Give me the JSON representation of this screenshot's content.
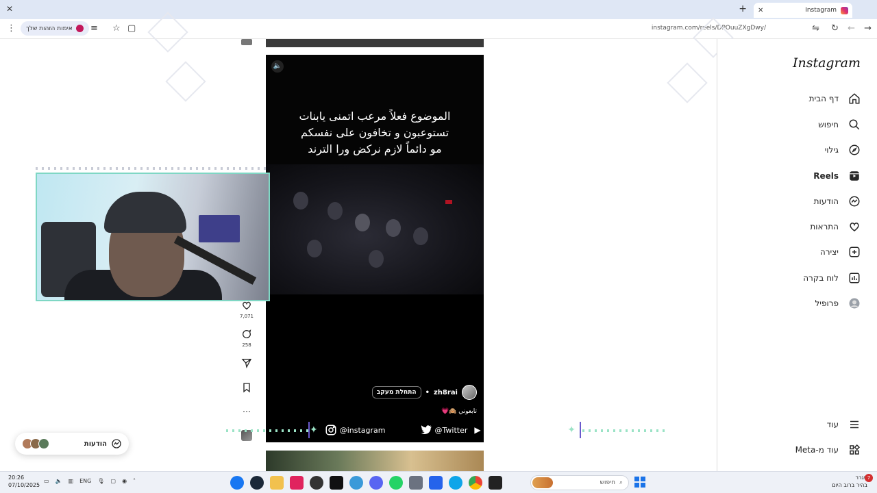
{
  "browser": {
    "tab_title": "Instagram",
    "url": "instagram.com/reels/DPOuuZXgDwy/",
    "profile_chip": "אימות הזהות שלך"
  },
  "sidebar": {
    "logo": "Instagram",
    "items": [
      {
        "label": "דף הבית",
        "icon": "home-icon"
      },
      {
        "label": "חיפוש",
        "icon": "search-icon"
      },
      {
        "label": "גילוי",
        "icon": "compass-icon"
      },
      {
        "label": "Reels",
        "icon": "reels-icon"
      },
      {
        "label": "הודעות",
        "icon": "messenger-icon"
      },
      {
        "label": "התראות",
        "icon": "heart-icon"
      },
      {
        "label": "יצירה",
        "icon": "plus-icon"
      },
      {
        "label": "לוח בקרה",
        "icon": "dashboard-icon"
      },
      {
        "label": "פרופיל",
        "icon": "avatar-icon"
      }
    ],
    "more": "עוד",
    "meta": "עוד מ-Meta"
  },
  "reel": {
    "caption_lines": [
      "الموضوع فعلاً مرعب اتمنى يابنات",
      "تستوعبون و تخافون على نفسكم",
      "مو دائماً لازم نركض ورا الترند"
    ],
    "author": "zh8rai",
    "follow_label": "התחלת מעקב",
    "description": "تابعوني 🙈💗",
    "likes": "7,071",
    "comments": "258"
  },
  "social_bar": {
    "instagram": "@instagram",
    "twitter": "@Twitter"
  },
  "messages_pill": {
    "label": "הודעות"
  },
  "taskbar": {
    "time": "20:26",
    "date": "07/10/2025",
    "lang": "ENG",
    "search_placeholder": "חיפוש",
    "weather_line1": "סגרר",
    "weather_line2": "בהיר ברוב היום",
    "notification_count": "7"
  },
  "colors": {
    "webcam_border": "#7fd7c4",
    "bracket": "#6a5acd",
    "windows_blue": "#1a73e8"
  }
}
